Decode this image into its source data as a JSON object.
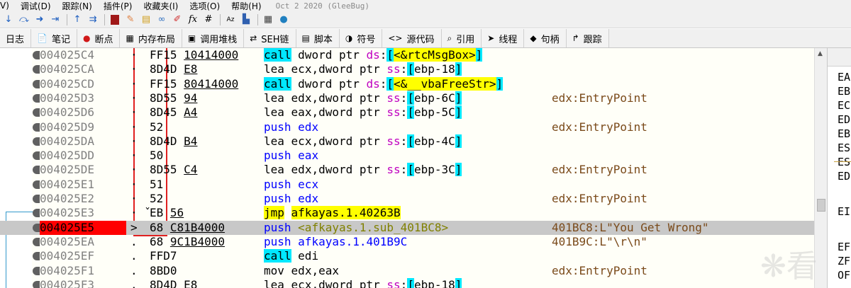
{
  "menu": [
    {
      "label": "V)"
    },
    {
      "label": "调试(D)"
    },
    {
      "label": "跟踪(N)"
    },
    {
      "label": "插件(P)"
    },
    {
      "label": "收藏夹(I)"
    },
    {
      "label": "选项(O)"
    },
    {
      "label": "帮助(H)"
    }
  ],
  "window_title": "Oct 2 2020 (GleeBug)",
  "toolbar_icons": [
    "step-into-icon",
    "step-over-icon",
    "run-to-cursor-icon",
    "run-until-return-icon",
    "step-up-icon",
    "animate-icon",
    "breakpoint-icon",
    "patch-icon",
    "note-icon",
    "link-icon",
    "pencil-icon",
    "fx-icon",
    "hash-icon",
    "font-icon",
    "script-icon",
    "calculator-icon",
    "globe-icon"
  ],
  "toolbar_glyphs": {
    "fx": "fx",
    "hash": "#",
    "font": "Az"
  },
  "tabs": [
    {
      "label": "日志",
      "icon": ""
    },
    {
      "label": "笔记",
      "icon": "📄"
    },
    {
      "label": "断点",
      "icon": "●"
    },
    {
      "label": "内存布局",
      "icon": "▦"
    },
    {
      "label": "调用堆栈",
      "icon": "▣"
    },
    {
      "label": "SEH链",
      "icon": "⇄"
    },
    {
      "label": "脚本",
      "icon": "▤"
    },
    {
      "label": "符号",
      "icon": "◑"
    },
    {
      "label": "源代码",
      "icon": "<>"
    },
    {
      "label": "引用",
      "icon": "⌕"
    },
    {
      "label": "线程",
      "icon": "➤"
    },
    {
      "label": "句柄",
      "icon": "◆"
    },
    {
      "label": "跟踪",
      "icon": "↱"
    }
  ],
  "disasm": [
    {
      "addr": "004025C4",
      "mark": "·",
      "b1": "FF15",
      "b2": "10414000",
      "op": "call",
      "text": "dword ptr ds:[<&rtcMsgBox>]",
      "cmt": ""
    },
    {
      "addr": "004025CA",
      "mark": "·",
      "b1": "8D4D",
      "b2": "E8",
      "op": "lea",
      "text": "ecx,dword ptr ss:[ebp-18]",
      "cmt": ""
    },
    {
      "addr": "004025CD",
      "mark": "·",
      "b1": "FF15",
      "b2": "80414000",
      "op": "call",
      "text": "dword ptr ds:[<&__vbaFreeStr>]",
      "cmt": ""
    },
    {
      "addr": "004025D3",
      "mark": "·",
      "b1": "8D55",
      "b2": "94",
      "op": "lea",
      "text": "edx,dword ptr ss:[ebp-6C]",
      "cmt": "edx:EntryPoint"
    },
    {
      "addr": "004025D6",
      "mark": "·",
      "b1": "8D45",
      "b2": "A4",
      "op": "lea",
      "text": "eax,dword ptr ss:[ebp-5C]",
      "cmt": ""
    },
    {
      "addr": "004025D9",
      "mark": "·",
      "b1": "52",
      "b2": "",
      "op": "push",
      "text": "edx",
      "cmt": "edx:EntryPoint"
    },
    {
      "addr": "004025DA",
      "mark": "·",
      "b1": "8D4D",
      "b2": "B4",
      "op": "lea",
      "text": "ecx,dword ptr ss:[ebp-4C]",
      "cmt": ""
    },
    {
      "addr": "004025DD",
      "mark": "·",
      "b1": "50",
      "b2": "",
      "op": "push",
      "text": "eax",
      "cmt": ""
    },
    {
      "addr": "004025DE",
      "mark": "·",
      "b1": "8D55",
      "b2": "C4",
      "op": "lea",
      "text": "edx,dword ptr ss:[ebp-3C]",
      "cmt": "edx:EntryPoint"
    },
    {
      "addr": "004025E1",
      "mark": "·",
      "b1": "51",
      "b2": "",
      "op": "push",
      "text": "ecx",
      "cmt": ""
    },
    {
      "addr": "004025E2",
      "mark": "·",
      "b1": "52",
      "b2": "",
      "op": "push",
      "text": "edx",
      "cmt": "edx:EntryPoint"
    },
    {
      "addr": "004025E3",
      "mark": "· ˇ",
      "b1": "EB",
      "b2": "56",
      "op": "jmp",
      "text": "afkayas.1.40263B",
      "cmt": ""
    },
    {
      "addr": "004025E5",
      "mark": ">",
      "b1": "68",
      "b2": "C81B4000",
      "op": "push",
      "text": "<afkayas.1.sub_401BC8>",
      "cmt": "401BC8:L\"You Get Wrong\""
    },
    {
      "addr": "004025EA",
      "mark": ".",
      "b1": "68",
      "b2": "9C1B4000",
      "op": "push",
      "text": "afkayas.1.401B9C",
      "cmt": "401B9C:L\"\\r\\n\""
    },
    {
      "addr": "004025EF",
      "mark": ".",
      "b1": "FFD7",
      "b2": "",
      "op": "call",
      "text": "edi",
      "cmt": ""
    },
    {
      "addr": "004025F1",
      "mark": ".",
      "b1": "8BD0",
      "b2": "",
      "op": "mov",
      "text": "edx,eax",
      "cmt": "edx:EntryPoint"
    },
    {
      "addr": "004025F3",
      "mark": ".",
      "b1": "8D4D",
      "b2": "E8",
      "op": "lea",
      "text": "ecx,dword ptr ss:[ebp-18]",
      "cmt": ""
    }
  ],
  "registers": [
    "EA",
    "EB",
    "EC",
    "ED",
    "EB",
    "ES",
    "ES",
    "ED",
    "",
    "EI",
    "",
    "EF",
    "ZF",
    "OF"
  ],
  "watermark": "看",
  "colors": {
    "current_ip": "#ff0000",
    "call_bg": "#00e8ff",
    "jmp_bg": "#ffff00",
    "push_fg": "#0000ff",
    "comment_fg": "#7a4a1a",
    "selected_row": "#c8c8c8"
  }
}
